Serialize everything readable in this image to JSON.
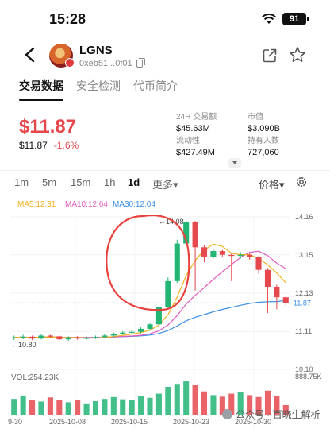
{
  "status_bar": {
    "time": "15:28",
    "battery": "91",
    "wifi_icon": "wifi-icon"
  },
  "token": {
    "name": "LGNS",
    "address": "0xeb51...0f01"
  },
  "tabs": [
    {
      "label": "交易数据",
      "active": true
    },
    {
      "label": "安全检测",
      "active": false
    },
    {
      "label": "代币简介",
      "active": false
    }
  ],
  "price": {
    "main": "$11.87",
    "value": "$11.87",
    "change": "-1.6%"
  },
  "stats": {
    "vol24h_label": "24H 交易额",
    "vol24h_value": "$45.63M",
    "mcap_label": "市值",
    "mcap_value": "$3.090B",
    "circ_label": "流动性",
    "circ_value": "$427.49M",
    "holders_label": "持有人数",
    "holders_value": "727,060"
  },
  "intervals": [
    "1m",
    "5m",
    "15m",
    "1h",
    "1d",
    "更多▾"
  ],
  "active_interval": "1d",
  "price_dropdown": "价格▾",
  "ma_legend": {
    "ma5": "MA5:12.31",
    "ma10": "MA10:12.64",
    "ma30": "MA30:12.04"
  },
  "volume_label": "VOL:254.23K",
  "watermark": "公众号 · 百晓生解析",
  "colors": {
    "up": "#22b574",
    "down": "#e5484d",
    "ma5": "#f2b01e",
    "ma10": "#e05cbf",
    "ma30": "#3a8ee6",
    "annotation": "#e8413c"
  },
  "chart_data": {
    "type": "candlestick",
    "y_ticks": [
      "14.16",
      "13.15",
      "12.13",
      "11.11",
      "10.10"
    ],
    "current_price_tag": "11.87",
    "low_label": "10.80",
    "high_label": "14.08",
    "volume_ticks": [
      "888.75K",
      "0"
    ],
    "x_ticks": [
      "9-30",
      "2025-10-08",
      "2025-10-15",
      "2025-10-23",
      "2025-10-30"
    ],
    "candles": [
      {
        "o": 10.93,
        "c": 10.95,
        "h": 11.0,
        "l": 10.88
      },
      {
        "o": 10.95,
        "c": 10.97,
        "h": 11.02,
        "l": 10.9
      },
      {
        "o": 10.97,
        "c": 10.92,
        "h": 11.0,
        "l": 10.88
      },
      {
        "o": 10.92,
        "c": 11.0,
        "h": 11.03,
        "l": 10.9
      },
      {
        "o": 11.0,
        "c": 10.98,
        "h": 11.02,
        "l": 10.93
      },
      {
        "o": 10.98,
        "c": 10.9,
        "h": 11.0,
        "l": 10.88
      },
      {
        "o": 10.9,
        "c": 10.95,
        "h": 10.98,
        "l": 10.86
      },
      {
        "o": 10.95,
        "c": 10.92,
        "h": 10.99,
        "l": 10.89
      },
      {
        "o": 10.92,
        "c": 10.94,
        "h": 10.98,
        "l": 10.9
      },
      {
        "o": 10.94,
        "c": 10.96,
        "h": 11.0,
        "l": 10.91
      },
      {
        "o": 10.96,
        "c": 11.0,
        "h": 11.04,
        "l": 10.93
      },
      {
        "o": 11.0,
        "c": 11.05,
        "h": 11.08,
        "l": 10.97
      },
      {
        "o": 11.05,
        "c": 11.08,
        "h": 11.12,
        "l": 11.02
      },
      {
        "o": 11.08,
        "c": 11.1,
        "h": 11.14,
        "l": 11.04
      },
      {
        "o": 11.1,
        "c": 11.18,
        "h": 11.22,
        "l": 11.06
      },
      {
        "o": 11.18,
        "c": 11.3,
        "h": 11.35,
        "l": 11.15
      },
      {
        "o": 11.3,
        "c": 11.75,
        "h": 11.82,
        "l": 11.25
      },
      {
        "o": 11.75,
        "c": 12.45,
        "h": 12.55,
        "l": 11.72
      },
      {
        "o": 12.45,
        "c": 13.45,
        "h": 13.55,
        "l": 12.4
      },
      {
        "o": 13.45,
        "c": 14.02,
        "h": 14.08,
        "l": 13.4
      },
      {
        "o": 14.02,
        "c": 13.35,
        "h": 14.05,
        "l": 12.2
      },
      {
        "o": 13.35,
        "c": 13.1,
        "h": 13.4,
        "l": 12.95
      },
      {
        "o": 13.1,
        "c": 13.25,
        "h": 13.3,
        "l": 13.05
      },
      {
        "o": 13.25,
        "c": 13.15,
        "h": 13.28,
        "l": 13.1
      },
      {
        "o": 13.15,
        "c": 13.12,
        "h": 13.2,
        "l": 12.45
      },
      {
        "o": 13.12,
        "c": 13.15,
        "h": 13.22,
        "l": 13.05
      },
      {
        "o": 13.15,
        "c": 13.1,
        "h": 13.2,
        "l": 13.02
      },
      {
        "o": 13.1,
        "c": 12.75,
        "h": 13.12,
        "l": 12.65
      },
      {
        "o": 12.75,
        "c": 12.3,
        "h": 12.8,
        "l": 11.6
      },
      {
        "o": 12.3,
        "c": 12.02,
        "h": 12.35,
        "l": 11.7
      },
      {
        "o": 12.02,
        "c": 11.87,
        "h": 12.05,
        "l": 11.8
      }
    ],
    "volumes_k": [
      420,
      510,
      380,
      350,
      460,
      400,
      330,
      380,
      300,
      360,
      420,
      470,
      410,
      380,
      500,
      450,
      560,
      740,
      820,
      888,
      800,
      620,
      520,
      480,
      560,
      600,
      520,
      470,
      640,
      500,
      254
    ],
    "ylim": [
      10.1,
      14.16
    ],
    "vol_max_k": 888.75
  }
}
